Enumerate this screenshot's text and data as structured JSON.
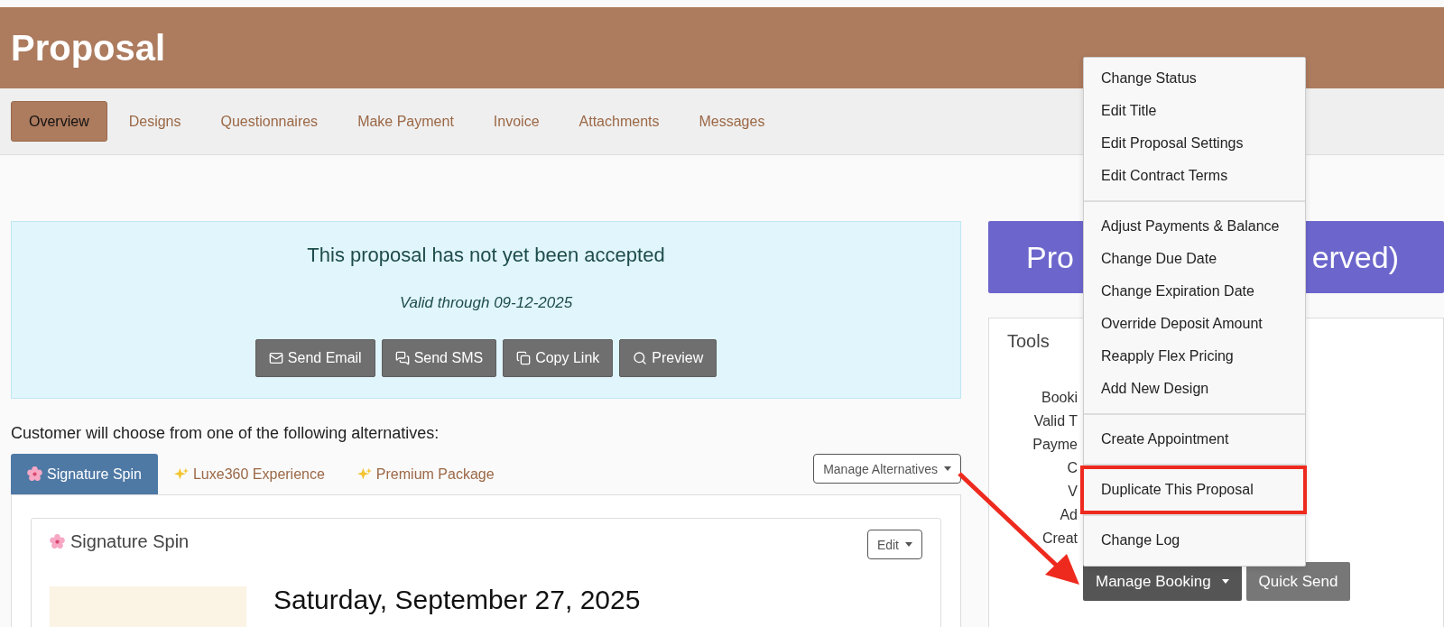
{
  "header": {
    "title": "Proposal"
  },
  "tabs": [
    {
      "label": "Overview",
      "selected": true
    },
    {
      "label": "Designs",
      "selected": false
    },
    {
      "label": "Questionnaires",
      "selected": false
    },
    {
      "label": "Make Payment",
      "selected": false
    },
    {
      "label": "Invoice",
      "selected": false
    },
    {
      "label": "Attachments",
      "selected": false
    },
    {
      "label": "Messages",
      "selected": false
    }
  ],
  "notice": {
    "headline": "This proposal has not yet been accepted",
    "valid_through": "Valid through 09-12-2025",
    "buttons": [
      {
        "label": "Send Email",
        "kind": "mail"
      },
      {
        "label": "Send SMS",
        "kind": "chat"
      },
      {
        "label": "Copy Link",
        "kind": "copy"
      },
      {
        "label": "Preview",
        "kind": "search"
      }
    ]
  },
  "alternatives": {
    "intro": "Customer will choose from one of the following alternatives:",
    "tabs": [
      {
        "label": "Signature Spin",
        "kind": "blossom",
        "selected": true
      },
      {
        "label": "Luxe360 Experience",
        "kind": "sparkles",
        "selected": false
      },
      {
        "label": "Premium Package",
        "kind": "sparkles",
        "selected": false
      }
    ],
    "manage_button": "Manage Alternatives",
    "card": {
      "title": "Signature Spin",
      "kind": "blossom",
      "edit_button": "Edit",
      "date": "Saturday, September 27, 2025"
    }
  },
  "status_banner": {
    "text_left": "Pro",
    "text_right": "erved)"
  },
  "tools": {
    "title": "Tools",
    "labels": [
      "Booki",
      "Valid T",
      "Payme",
      "C",
      "V",
      "Ad",
      "Creat"
    ],
    "buttons": [
      {
        "label": "Manage Booking",
        "kind": "dropdown"
      },
      {
        "label": "Quick Send",
        "kind": "plain"
      }
    ]
  },
  "menu": {
    "groups": [
      [
        {
          "label": "Change Status",
          "annotated": false
        },
        {
          "label": "Edit Title",
          "annotated": false
        },
        {
          "label": "Edit Proposal Settings",
          "annotated": false
        },
        {
          "label": "Edit Contract Terms",
          "annotated": false
        }
      ],
      [
        {
          "label": "Adjust Payments & Balance",
          "annotated": false
        },
        {
          "label": "Change Due Date",
          "annotated": false
        },
        {
          "label": "Change Expiration Date",
          "annotated": false
        },
        {
          "label": "Override Deposit Amount",
          "annotated": false
        },
        {
          "label": "Reapply Flex Pricing",
          "annotated": false
        },
        {
          "label": "Add New Design",
          "annotated": false
        }
      ],
      [
        {
          "label": "Create Appointment",
          "annotated": false
        }
      ],
      [
        {
          "label": "Duplicate This Proposal",
          "annotated": true
        }
      ],
      [
        {
          "label": "Change Log",
          "annotated": false
        }
      ]
    ]
  }
}
